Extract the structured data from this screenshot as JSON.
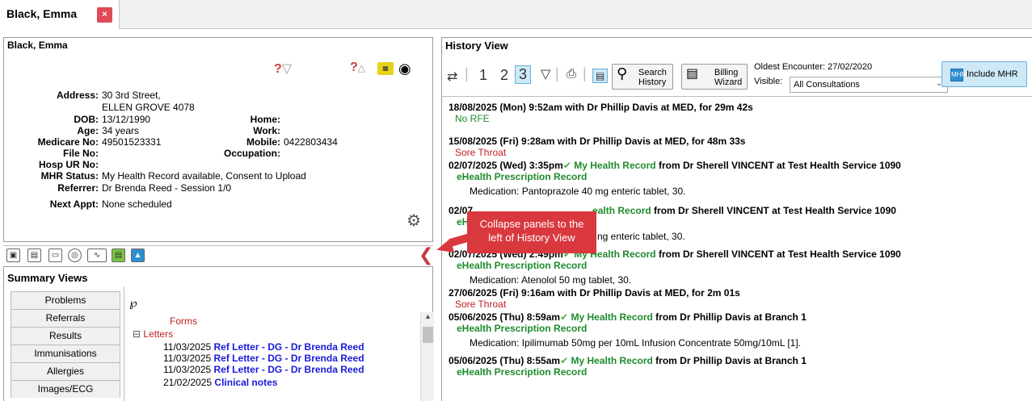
{
  "tab": {
    "title": "Black, Emma",
    "close_label": "×"
  },
  "patient": {
    "panel_title": "Black, Emma",
    "fields_left": [
      {
        "label": "Address:",
        "value": "30 3rd Street,"
      },
      {
        "label": "",
        "value": "ELLEN GROVE  4078"
      },
      {
        "label": "DOB:",
        "value": "13/12/1990"
      },
      {
        "label": "Age:",
        "value": "34 years"
      },
      {
        "label": "Medicare No:",
        "value": "49501523331"
      },
      {
        "label": "File No:",
        "value": ""
      },
      {
        "label": "Hosp UR No:",
        "value": ""
      },
      {
        "label": "MHR Status:",
        "value": "My Health Record available, Consent to Upload"
      },
      {
        "label": "Referrer:",
        "value": "Dr Brenda Reed - Session 1/0"
      },
      {
        "label": "Next Appt:",
        "value": "None scheduled"
      }
    ],
    "fields_right": [
      {
        "label": "Home:",
        "value": ""
      },
      {
        "label": "Work:",
        "value": ""
      },
      {
        "label": "Mobile:",
        "value": "0422803434"
      },
      {
        "label": "Occupation:",
        "value": ""
      }
    ]
  },
  "summary": {
    "title": "Summary Views",
    "tabs": [
      "Problems",
      "Referrals",
      "Results",
      "Immunisations",
      "Allergies",
      "Images/ECG"
    ],
    "forms_label": "Forms",
    "letters_label": "Letters",
    "letters": [
      {
        "date": "11/03/2025",
        "text": "Ref Letter - DG - Dr Brenda Reed"
      },
      {
        "date": "11/03/2025",
        "text": "Ref Letter - DG - Dr Brenda Reed"
      },
      {
        "date": "11/03/2025",
        "text": "Ref Letter - DG - Dr Brenda Reed"
      },
      {
        "date": "21/02/2025",
        "text": "Clinical notes"
      }
    ]
  },
  "history": {
    "title": "History View",
    "pages": [
      "1",
      "2",
      "3"
    ],
    "search_label_1": "Search",
    "search_label_2": "History",
    "billing_label_1": "Billing",
    "billing_label_2": "Wizard",
    "oldest_encounter": "Oldest Encounter: 27/02/2020",
    "visible_label": "Visible:",
    "visible_value": "All Consultations",
    "include_mhr": "Include MHR",
    "entries": [
      {
        "kind": "head",
        "text": "18/08/2025 (Mon) 9:52am with Dr Phillip Davis at MED, for 29m 42s"
      },
      {
        "kind": "green",
        "text": "No RFE"
      },
      {
        "kind": "head",
        "text": "15/08/2025 (Fri) 9:28am with Dr Phillip Davis at MED, for 48m 33s"
      },
      {
        "kind": "red",
        "text": "Sore Throat"
      },
      {
        "kind": "mhr",
        "date": "02/07/2025 (Wed) 3:35pm",
        "mhr": "My Health Record",
        "rest": " from Dr Sherell VINCENT  at Test Health Service 1090"
      },
      {
        "kind": "sub",
        "text": "eHealth Prescription Record"
      },
      {
        "kind": "med",
        "text": "Medication: Pantoprazole 40 mg enteric tablet, 30."
      },
      {
        "kind": "mhr",
        "date": "02/07",
        "mhr": "ealth Record",
        "rest": " from Dr Sherell VINCENT  at Test Health Service 1090"
      },
      {
        "kind": "sub",
        "text": "eH"
      },
      {
        "kind": "med",
        "text": "ng enteric tablet, 30."
      },
      {
        "kind": "mhr",
        "date": "02/07/2025 (Wed) 2:49pm",
        "mhr": "My Health Record",
        "rest": " from Dr Sherell VINCENT  at Test Health Service 1090"
      },
      {
        "kind": "sub",
        "text": "eHealth Prescription Record"
      },
      {
        "kind": "med",
        "text": "Medication: Atenolol 50 mg tablet, 30."
      },
      {
        "kind": "head",
        "text": "27/06/2025 (Fri) 9:16am with Dr Phillip Davis at MED, for 2m 01s"
      },
      {
        "kind": "red",
        "text": "Sore Throat"
      },
      {
        "kind": "mhr",
        "date": "05/06/2025 (Thu) 8:59am",
        "mhr": "My Health Record",
        "rest": " from Dr Phillip Davis  at Branch 1"
      },
      {
        "kind": "sub",
        "text": "eHealth Prescription Record"
      },
      {
        "kind": "med",
        "text": "Medication: Ipilimumab 50mg per 10mL Infusion Concentrate 50mg/10mL [1]."
      },
      {
        "kind": "mhr",
        "date": "05/06/2025 (Thu) 8:55am",
        "mhr": "My Health Record",
        "rest": " from Dr Phillip Davis  at Branch 1"
      },
      {
        "kind": "sub",
        "text": "eHealth Prescription Record"
      }
    ]
  },
  "callout": {
    "line1": "Collapse panels to the",
    "line2": "left of History View"
  },
  "colors": {
    "accent_red": "#d9383f",
    "mhr_green": "#1e8b2c",
    "link_blue": "#1a1adb"
  }
}
